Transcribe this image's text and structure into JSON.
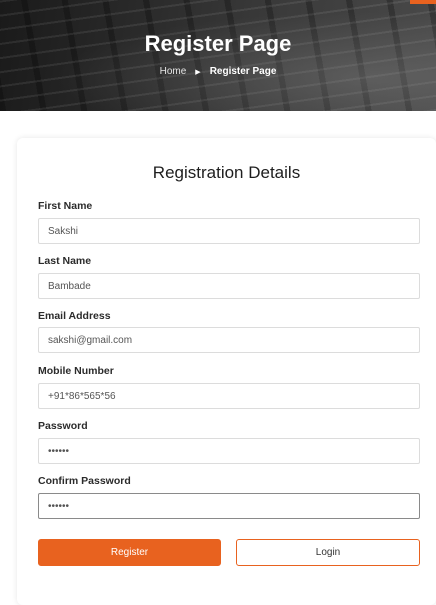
{
  "hero": {
    "title": "Register Page",
    "breadcrumb": {
      "home": "Home",
      "separator": "▶",
      "current": "Register Page"
    }
  },
  "form": {
    "title": "Registration Details",
    "fields": {
      "first_name": {
        "label": "First Name",
        "value": "Sakshi"
      },
      "last_name": {
        "label": "Last Name",
        "value": "Bambade"
      },
      "email": {
        "label": "Email Address",
        "value": "sakshi@gmail.com"
      },
      "mobile": {
        "label": "Mobile Number",
        "value": "+91*86*565*56"
      },
      "password": {
        "label": "Password",
        "value": "••••••"
      },
      "confirm_password": {
        "label": "Confirm Password",
        "value": "••••••"
      }
    },
    "buttons": {
      "register": "Register",
      "login": "Login"
    }
  },
  "colors": {
    "accent": "#e8621f"
  }
}
